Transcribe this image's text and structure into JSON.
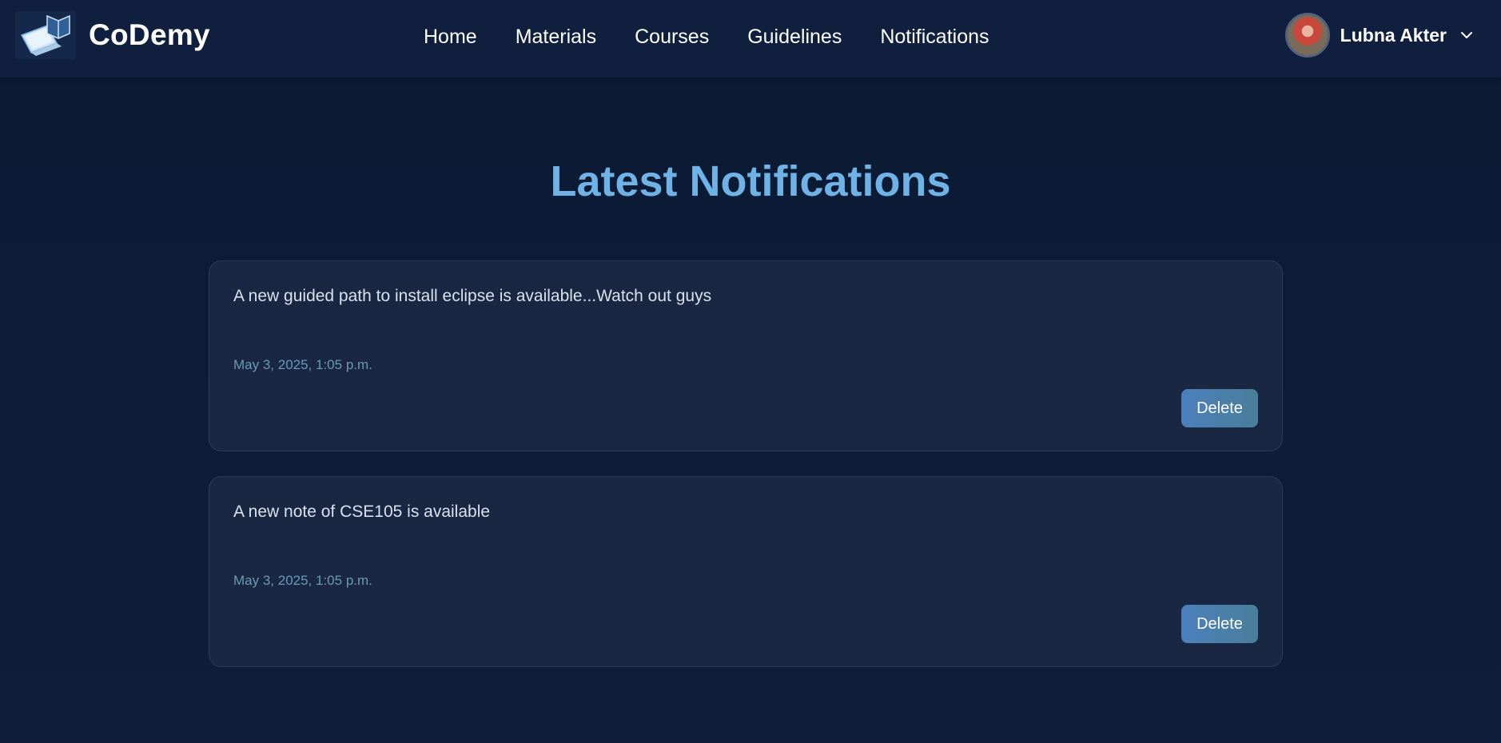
{
  "brand": {
    "name": "CoDemy",
    "logo_icon": "laptop-book-icon"
  },
  "nav": {
    "items": [
      {
        "label": "Home"
      },
      {
        "label": "Materials"
      },
      {
        "label": "Courses"
      },
      {
        "label": "Guidelines"
      },
      {
        "label": "Notifications"
      }
    ]
  },
  "user": {
    "name": "Lubna Akter",
    "avatar_icon": "user-avatar",
    "dropdown_icon": "chevron-down-icon"
  },
  "page": {
    "title": "Latest Notifications"
  },
  "notifications": [
    {
      "message": "A new guided path to install eclipse is available...Watch out guys",
      "timestamp": "May 3, 2025, 1:05 p.m.",
      "delete_label": "Delete"
    },
    {
      "message": "A new note of CSE105 is available",
      "timestamp": "May 3, 2025, 1:05 p.m.",
      "delete_label": "Delete"
    }
  ],
  "colors": {
    "background": "#0b1a33",
    "navbar": "#0f1f3d",
    "title": "#6fb3e6",
    "card": "#1a2742",
    "timestamp": "#6a9ab4",
    "button": "#4b80bd"
  }
}
